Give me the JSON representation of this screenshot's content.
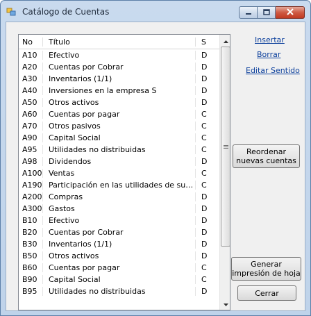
{
  "window": {
    "title": "Catálogo de Cuentas"
  },
  "grid": {
    "headers": {
      "no": "No",
      "title": "Título",
      "s": "S"
    },
    "rows": [
      {
        "no": "A10",
        "title": "Efectivo",
        "s": "D"
      },
      {
        "no": "A20",
        "title": "Cuentas por Cobrar",
        "s": "D"
      },
      {
        "no": "A30",
        "title": "Inventarios (1/1)",
        "s": "D"
      },
      {
        "no": "A40",
        "title": "Inversiones en la empresa S",
        "s": "D"
      },
      {
        "no": "A50",
        "title": "Otros activos",
        "s": "D"
      },
      {
        "no": "A60",
        "title": "Cuentas por pagar",
        "s": "C"
      },
      {
        "no": "A70",
        "title": "Otros pasivos",
        "s": "C"
      },
      {
        "no": "A90",
        "title": "Capital Social",
        "s": "C"
      },
      {
        "no": "A95",
        "title": "Utilidades no distribuidas",
        "s": "C"
      },
      {
        "no": "A98",
        "title": "Dividendos",
        "s": "D"
      },
      {
        "no": "A100",
        "title": "Ventas",
        "s": "C"
      },
      {
        "no": "A190",
        "title": "Participación en las utilidades de subsidiari...",
        "s": "C"
      },
      {
        "no": "A200",
        "title": "Compras",
        "s": "D"
      },
      {
        "no": "A300",
        "title": "Gastos",
        "s": "D"
      },
      {
        "no": "B10",
        "title": "Efectivo",
        "s": "D"
      },
      {
        "no": "B20",
        "title": "Cuentas por Cobrar",
        "s": "D"
      },
      {
        "no": "B30",
        "title": "Inventarios (1/1)",
        "s": "D"
      },
      {
        "no": "B50",
        "title": "Otros activos",
        "s": "D"
      },
      {
        "no": "B60",
        "title": "Cuentas por pagar",
        "s": "C"
      },
      {
        "no": "B90",
        "title": "Capital Social",
        "s": "C"
      },
      {
        "no": "B95",
        "title": "Utilidades no distribuidas",
        "s": "D"
      }
    ]
  },
  "links": {
    "insert": "Insertar",
    "delete": "Borrar",
    "edit_sense": "Editar Sentido"
  },
  "buttons": {
    "reorder_line1": "Reordenar",
    "reorder_line2": "nuevas cuentas",
    "print_line1": "Generar",
    "print_line2": "impresión de hoja",
    "close": "Cerrar"
  },
  "icons": {
    "app": "app-icon",
    "minimize": "minimize-icon",
    "maximize": "maximize-icon",
    "close": "close-icon",
    "scroll_up": "chevron-up-icon",
    "scroll_down": "chevron-down-icon",
    "scroll_grip": "grip-icon"
  }
}
